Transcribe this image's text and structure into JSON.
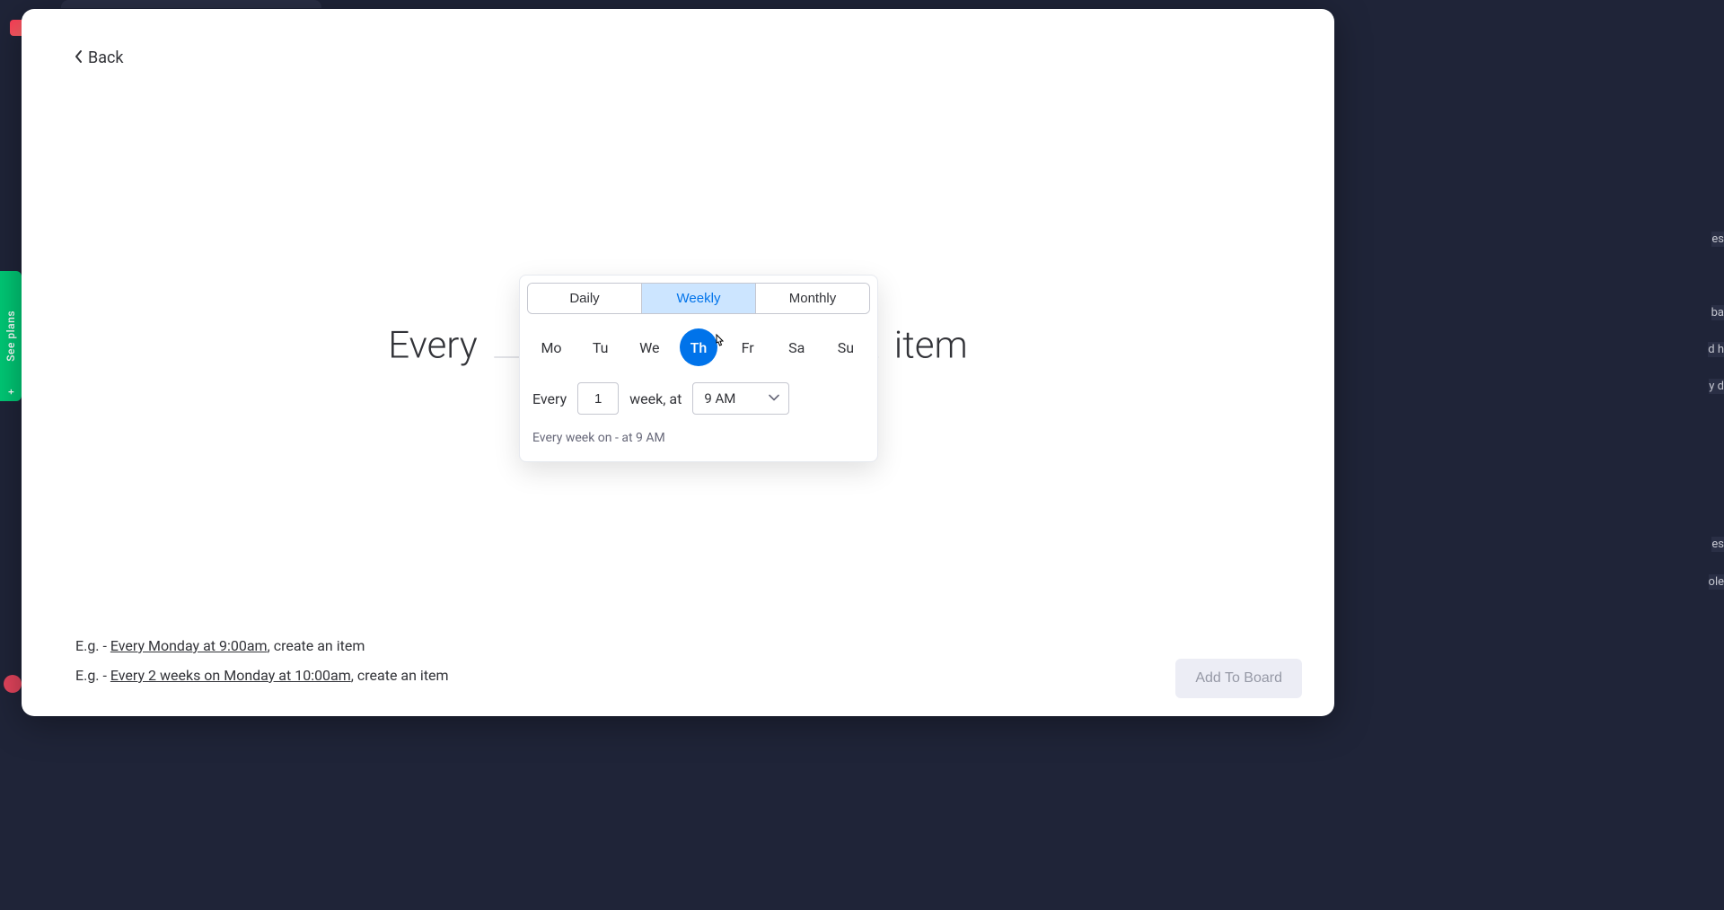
{
  "modal": {
    "back_label": "Back",
    "sentence": {
      "prefix": "Every",
      "suffix": "item"
    },
    "add_button": "Add To Board"
  },
  "popover": {
    "tabs": {
      "daily": "Daily",
      "weekly": "Weekly",
      "monthly": "Monthly",
      "active": "weekly"
    },
    "days": {
      "mo": "Mo",
      "tu": "Tu",
      "we": "We",
      "th": "Th",
      "fr": "Fr",
      "sa": "Sa",
      "su": "Su",
      "selected": "th"
    },
    "every_label": "Every",
    "interval_value": "1",
    "week_at_label": "week, at",
    "time_value": "9 AM",
    "summary": "Every week on - at 9 AM"
  },
  "examples": [
    {
      "prefix": "E.g. - ",
      "underline": "Every Monday at 9:00am",
      "suffix": ", create an item"
    },
    {
      "prefix": "E.g. - ",
      "underline": "Every 2 weeks on Monday at 10:00am",
      "suffix": ", create an item"
    }
  ],
  "background": {
    "see_plans": "See plans",
    "plus": "+",
    "frag1": "es",
    "frag2": "ba",
    "frag3": "d h",
    "frag4": "y d",
    "frag5": "es",
    "frag6": "ole"
  }
}
